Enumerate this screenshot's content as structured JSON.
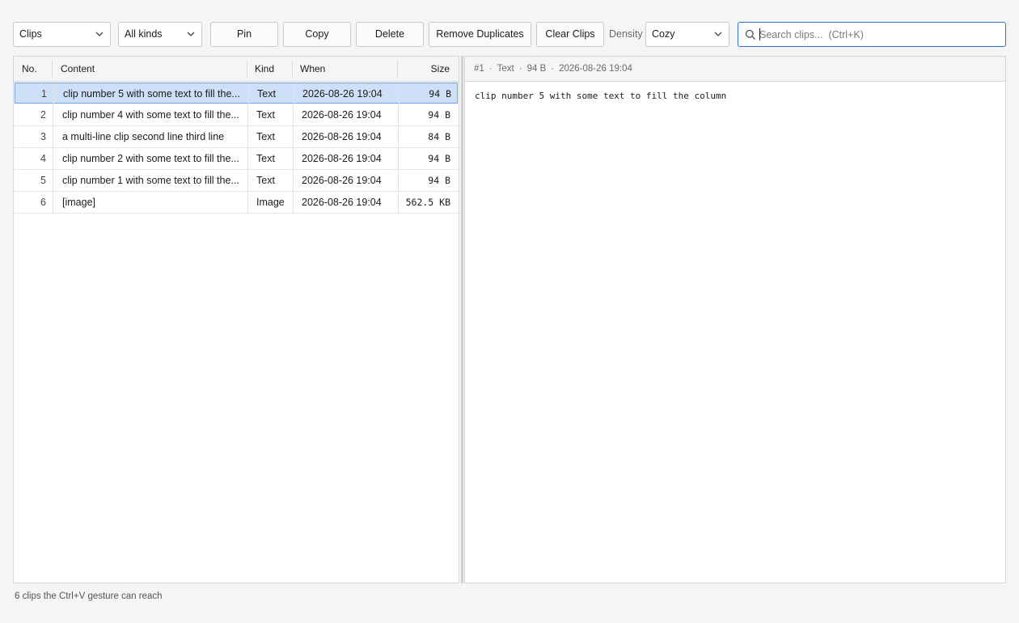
{
  "toolbar": {
    "view_select": "Clips",
    "kind_select": "All kinds",
    "pin_label": "Pin",
    "copy_label": "Copy",
    "delete_label": "Delete",
    "remove_duplicates_label": "Remove Duplicates",
    "clear_clips_label": "Clear Clips",
    "density_label": "Density",
    "density_select": "Cozy",
    "search_placeholder": "Search clips...  (Ctrl+K)",
    "search_value": ""
  },
  "table": {
    "columns": {
      "no": "No.",
      "content": "Content",
      "kind": "Kind",
      "when": "When",
      "size": "Size"
    },
    "rows": [
      {
        "no": "1",
        "content": "clip number 5 with some text to fill the...",
        "kind": "Text",
        "when": "2026-08-26 19:04",
        "size": "94 B",
        "selected": true
      },
      {
        "no": "2",
        "content": "clip number 4 with some text to fill the...",
        "kind": "Text",
        "when": "2026-08-26 19:04",
        "size": "94 B"
      },
      {
        "no": "3",
        "content": "a multi-line clip second line third line",
        "kind": "Text",
        "when": "2026-08-26 19:04",
        "size": "84 B"
      },
      {
        "no": "4",
        "content": "clip number 2 with some text to fill the...",
        "kind": "Text",
        "when": "2026-08-26 19:04",
        "size": "94 B"
      },
      {
        "no": "5",
        "content": "clip number 1 with some text to fill the...",
        "kind": "Text",
        "when": "2026-08-26 19:04",
        "size": "94 B"
      },
      {
        "no": "6",
        "content": "[image]",
        "kind": "Image",
        "when": "2026-08-26 19:04",
        "size": "562.5 KB"
      }
    ]
  },
  "preview": {
    "meta_id": "#1",
    "meta_kind": "Text",
    "meta_size": "94 B",
    "meta_when": "2026-08-26 19:04",
    "separator": "·",
    "body": "clip number 5 with some text to fill the column"
  },
  "status": {
    "text": "6 clips the Ctrl+V gesture can reach"
  },
  "colors": {
    "accent": "#2f6fd1",
    "selection_bg": "#cde0f7",
    "selection_border": "#6fa2e6"
  },
  "icons": {
    "dropdown": "chevron-down-icon",
    "search": "search-icon"
  }
}
